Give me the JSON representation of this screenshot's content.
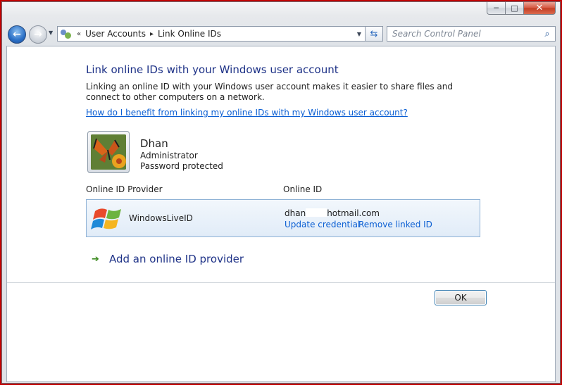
{
  "window": {
    "min_glyph": "─",
    "max_glyph": "□",
    "close_glyph": "✕"
  },
  "nav": {
    "back_glyph": "←",
    "forward_glyph": "→",
    "recent_glyph": "▼",
    "breadcrumb_prefix": "«",
    "breadcrumbs": [
      "User Accounts",
      "Link Online IDs"
    ],
    "breadcrumb_separator": "▸",
    "dropdown_glyph": "▼",
    "refresh_glyph": "⇆",
    "search_placeholder": "Search Control Panel",
    "search_glyph": "⌕"
  },
  "page": {
    "title": "Link online IDs with your Windows user account",
    "description": "Linking an online ID with your Windows user account makes it easier to share files and connect to other computers on a network.",
    "help_link": "How do I benefit from linking my online IDs with my Windows user account?"
  },
  "user": {
    "name": "Dhan",
    "role": "Administrator",
    "status": "Password protected"
  },
  "table": {
    "provider_header": "Online ID Provider",
    "id_header": "Online ID",
    "rows": [
      {
        "provider": "WindowsLiveID",
        "id_prefix": "dhan",
        "id_suffix": "hotmail.com",
        "update_link": "Update credential",
        "remove_link": "Remove linked ID"
      }
    ]
  },
  "add_provider": {
    "arrow_glyph": "➔",
    "label": "Add an online ID provider"
  },
  "buttons": {
    "ok": "OK"
  },
  "colors": {
    "heading": "#1e3287",
    "link": "#0a5ed3",
    "row_border": "#8fb2d6"
  }
}
